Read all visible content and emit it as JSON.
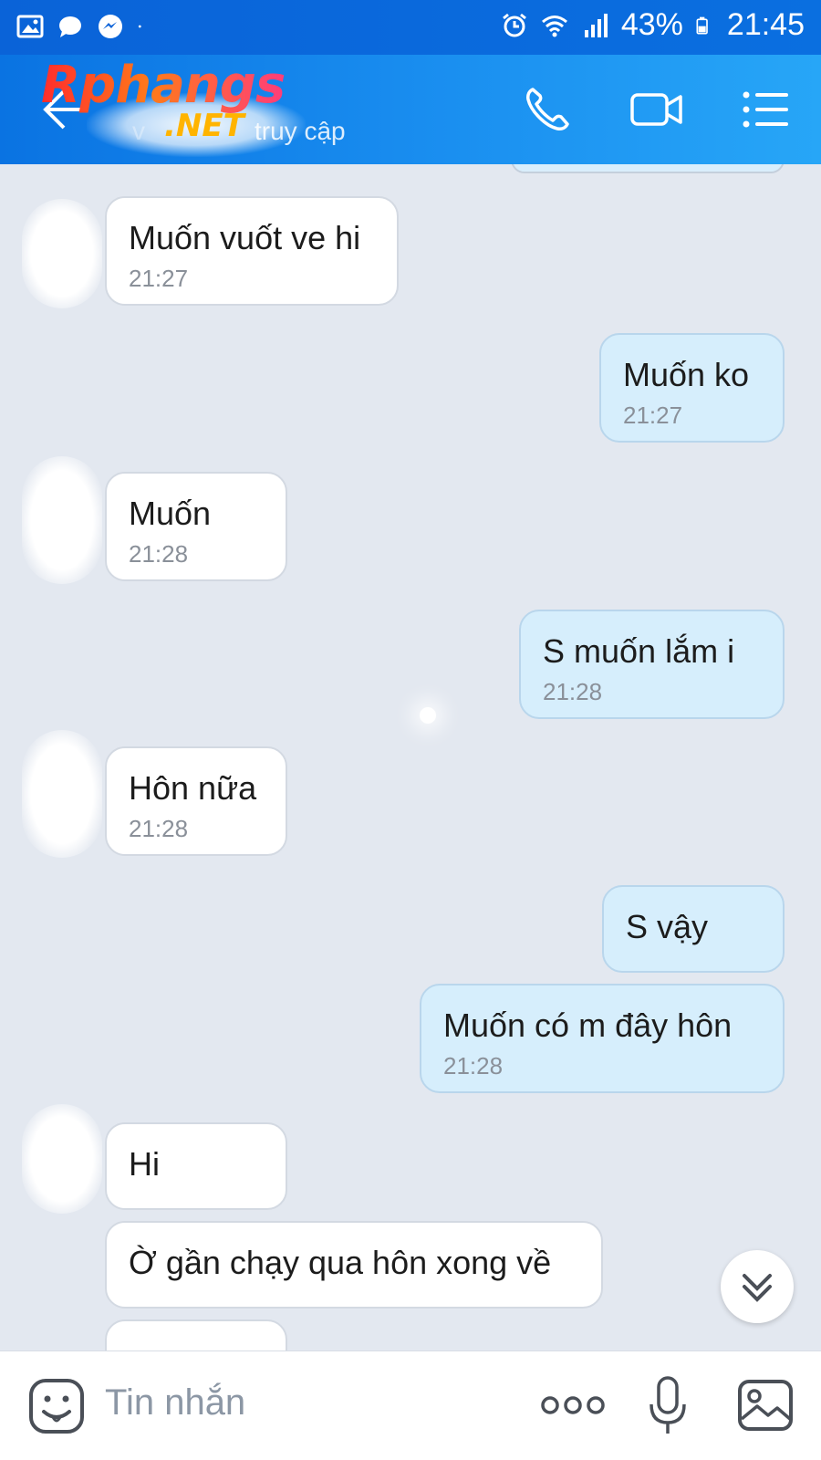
{
  "status_bar": {
    "battery": "43%",
    "time": "21:45",
    "icons": [
      "gallery-icon",
      "chat-bubble-icon",
      "messenger-icon",
      "dot-icon",
      "alarm-icon",
      "wifi-icon",
      "signal-icon",
      "battery-icon"
    ]
  },
  "header": {
    "logo_main": "Rphangs",
    "logo_sub": ".NET",
    "subtitle": "truy cập",
    "actions": [
      "phone-icon",
      "video-call-icon",
      "menu-icon"
    ],
    "accent": "#0a73e2"
  },
  "messages": [
    {
      "dir": "in",
      "text": "Muốn vuốt ve hi",
      "time": "21:27"
    },
    {
      "dir": "out",
      "text": "Muốn ko",
      "time": "21:27"
    },
    {
      "dir": "in",
      "text": "Muốn",
      "time": "21:28"
    },
    {
      "dir": "out",
      "text": "S muốn lắm i",
      "time": "21:28"
    },
    {
      "dir": "in",
      "text": "Hôn nữa",
      "time": "21:28"
    },
    {
      "dir": "out",
      "text": "S vậy",
      "time": ""
    },
    {
      "dir": "out",
      "text": "Muốn có m đây hôn",
      "time": "21:28"
    },
    {
      "dir": "in",
      "text": "Hi",
      "time": ""
    },
    {
      "dir": "in",
      "text": "Ờ gần chạy qua hôn xong về",
      "time": ""
    }
  ],
  "input": {
    "placeholder": "Tin nhắn",
    "icons": [
      "emoji-icon",
      "more-icon",
      "microphone-icon",
      "image-icon"
    ]
  },
  "colors": {
    "chat_bg": "#e3e8f0",
    "outgoing_bubble": "#d6eefc",
    "incoming_bubble": "#ffffff"
  }
}
